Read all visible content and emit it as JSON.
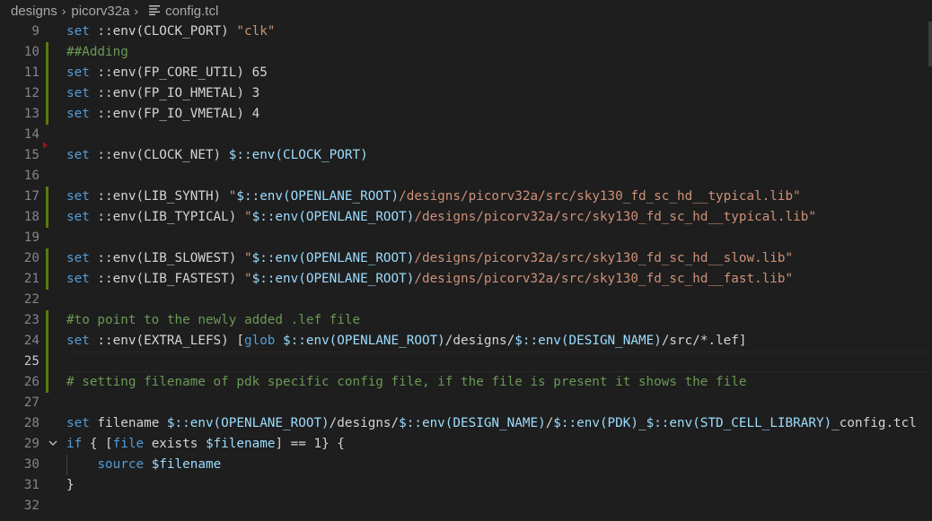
{
  "breadcrumb": {
    "items": [
      "designs",
      "picorv32a"
    ],
    "file": "config.tcl"
  },
  "editor": {
    "active_line": 25,
    "lines": [
      {
        "n": "9",
        "html": "<span class=\"k\">set</span> ::env(CLOCK_PORT) <span class=\"s\">\"clk\"</span>"
      },
      {
        "n": "10",
        "html": "<span class=\"c\">##Adding</span>"
      },
      {
        "n": "11",
        "html": "<span class=\"k\">set</span> ::env(FP_CORE_UTIL) 65"
      },
      {
        "n": "12",
        "html": "<span class=\"k\">set</span> ::env(FP_IO_HMETAL) 3"
      },
      {
        "n": "13",
        "html": "<span class=\"k\">set</span> ::env(FP_IO_VMETAL) 4"
      },
      {
        "n": "14",
        "html": ""
      },
      {
        "n": "15",
        "html": "<span class=\"k\">set</span> ::env(CLOCK_NET) <span class=\"v\">$::env(CLOCK_PORT)</span>"
      },
      {
        "n": "16",
        "html": ""
      },
      {
        "n": "17",
        "html": "<span class=\"k\">set</span> ::env(LIB_SYNTH) <span class=\"s\">\"</span><span class=\"v\">$::env(OPENLANE_ROOT)</span><span class=\"s\">/designs/picorv32a/src/sky130_fd_sc_hd__typical.lib\"</span>"
      },
      {
        "n": "18",
        "html": "<span class=\"k\">set</span> ::env(LIB_TYPICAL) <span class=\"s\">\"</span><span class=\"v\">$::env(OPENLANE_ROOT)</span><span class=\"s\">/designs/picorv32a/src/sky130_fd_sc_hd__typical.lib\"</span>"
      },
      {
        "n": "19",
        "html": ""
      },
      {
        "n": "20",
        "html": "<span class=\"k\">set</span> ::env(LIB_SLOWEST) <span class=\"s\">\"</span><span class=\"v\">$::env(OPENLANE_ROOT)</span><span class=\"s\">/designs/picorv32a/src/sky130_fd_sc_hd__slow.lib\"</span>"
      },
      {
        "n": "21",
        "html": "<span class=\"k\">set</span> ::env(LIB_FASTEST) <span class=\"s\">\"</span><span class=\"v\">$::env(OPENLANE_ROOT)</span><span class=\"s\">/designs/picorv32a/src/sky130_fd_sc_hd__fast.lib\"</span>"
      },
      {
        "n": "22",
        "html": ""
      },
      {
        "n": "23",
        "html": "<span class=\"c\">#to point to the newly added .lef file</span>"
      },
      {
        "n": "24",
        "html": "<span class=\"k\">set</span> ::env(EXTRA_LEFS) [<span class=\"k\">glob</span> <span class=\"v\">$::env(OPENLANE_ROOT)</span>/designs/<span class=\"v\">$::env(DESIGN_NAME)</span>/src/*.lef]"
      },
      {
        "n": "25",
        "html": ""
      },
      {
        "n": "26",
        "html": "<span class=\"c\"># setting filename of pdk specific config file, if the file is present it shows the file</span>"
      },
      {
        "n": "27",
        "html": ""
      },
      {
        "n": "28",
        "html": "<span class=\"k\">set</span> filename <span class=\"v\">$::env(OPENLANE_ROOT)</span>/designs/<span class=\"v\">$::env(DESIGN_NAME)</span>/<span class=\"v\">$::env(PDK)</span>_<span class=\"v\">$::env(STD_CELL_LIBRARY)</span>_config.tcl"
      },
      {
        "n": "29",
        "html": "<span class=\"k\">if</span> { [<span class=\"k\">file</span> exists <span class=\"v\">$filename</span>] == 1} {"
      },
      {
        "n": "30",
        "html": "    <span class=\"k\">source</span> <span class=\"v\">$filename</span>"
      },
      {
        "n": "31",
        "html": "}"
      },
      {
        "n": "32",
        "html": ""
      }
    ]
  },
  "gutter_marks": {
    "modified": [
      10,
      11,
      12,
      13,
      17,
      18,
      20,
      21,
      23,
      24,
      25,
      26
    ],
    "deleted_after": 14,
    "fold_line": 29,
    "fold_icon": "chevron-down-icon",
    "file_icon": "file-lines-icon",
    "separator_icon": "chevron-right-icon"
  },
  "colors": {
    "background": "#1e1e1e",
    "keyword": "#569cd6",
    "string": "#ce9178",
    "comment": "#6a9955",
    "variable": "#9cdcfe",
    "gutter_modified": "#587c0c",
    "gutter_deleted": "#94151b"
  }
}
